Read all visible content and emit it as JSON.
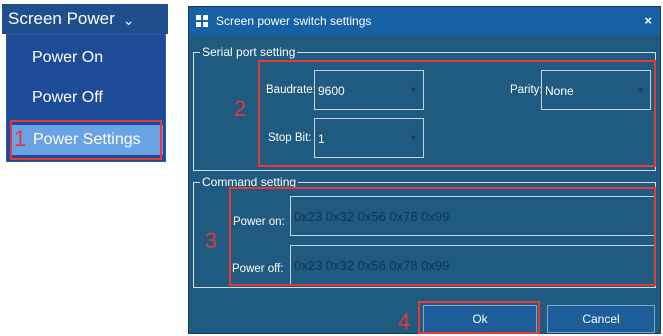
{
  "menu": {
    "title": "Screen Power",
    "chevron": "⌄",
    "items": [
      {
        "label": "Power On"
      },
      {
        "label": "Power Off"
      },
      {
        "label": "Power Settings"
      }
    ]
  },
  "dialog": {
    "title": "Screen power switch settings",
    "close": "×",
    "serial": {
      "legend": "Serial port setting",
      "baudrate_label": "Baudrate:",
      "baudrate_value": "9600",
      "parity_label": "Parity:",
      "parity_value": "None",
      "stopbit_label": "Stop Bit:",
      "stopbit_value": "1"
    },
    "command": {
      "legend": "Command setting",
      "power_on_label": "Power on:",
      "power_on_placeholder": "0x23 0x32 0x56 0x78 0x99",
      "power_off_label": "Power off:",
      "power_off_placeholder": "0x23 0x32 0x56 0x78 0x99"
    },
    "ok_label": "Ok",
    "cancel_label": "Cancel"
  },
  "annotations": [
    "1",
    "2",
    "3",
    "4"
  ],
  "colors": {
    "menu_bg": "#1c4c97",
    "highlight": "#6aa2e6",
    "dialog_bg": "#1f5a80",
    "titlebar": "#1660a6",
    "annotation": "#e53935"
  }
}
